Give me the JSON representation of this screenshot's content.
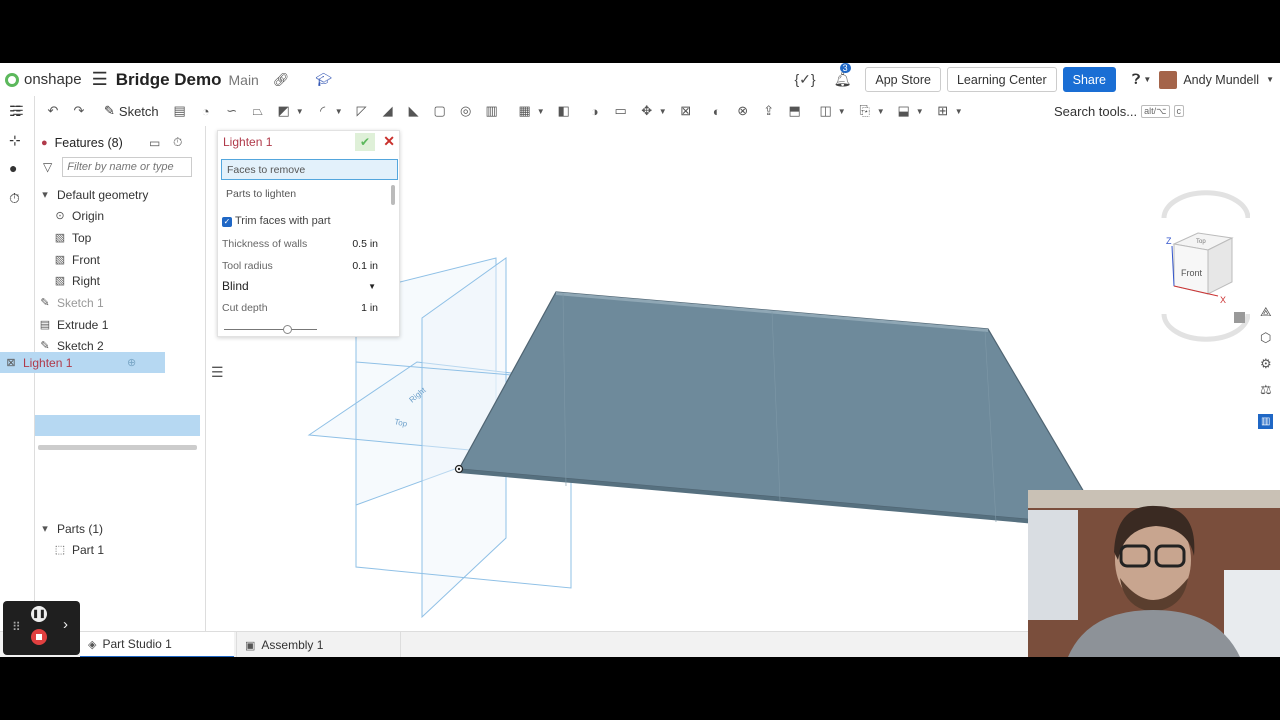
{
  "topbar": {
    "logo_text": "onshape",
    "doc_title": "Bridge Demo",
    "branch": "Main",
    "notifications_count": "3",
    "app_store": "App Store",
    "learning_center": "Learning Center",
    "share": "Share",
    "user_name": "Andy Mundell"
  },
  "toolbar": {
    "sketch_label": "Sketch",
    "search_label": "Search tools...",
    "search_shortcut_1": "alt/⌥",
    "search_shortcut_2": "c"
  },
  "tree": {
    "features_title": "Features (8)",
    "filter_placeholder": "Filter by name or type",
    "default_geometry": "Default geometry",
    "items": [
      "Origin",
      "Top",
      "Front",
      "Right",
      "Sketch 1",
      "Extrude 1",
      "Sketch 2",
      "Lighten 1"
    ],
    "parts_title": "Parts (1)",
    "part_1": "Part 1"
  },
  "dialog": {
    "title": "Lighten 1",
    "faces_to_remove": "Faces to remove",
    "parts_to_lighten": "Parts to lighten",
    "trim_faces": "Trim faces with part",
    "thickness_label": "Thickness of walls",
    "thickness_value": "0.5 in",
    "tool_radius_label": "Tool radius",
    "tool_radius_value": "0.1 in",
    "end_type": "Blind",
    "cut_depth_label": "Cut depth",
    "cut_depth_value": "1 in"
  },
  "viewcube": {
    "face_label": "Front",
    "top_label": "Top",
    "axis_z": "Z",
    "axis_x": "X"
  },
  "viewport": {
    "plane_top": "Top",
    "plane_right": "Right"
  },
  "tabs": {
    "part_studio": "Part Studio 1",
    "assembly": "Assembly 1"
  },
  "colors": {
    "part_fill": "#6e8a9b",
    "selection_blue": "#b6d8f2",
    "feature_red": "#b03a4a",
    "accent_blue": "#1a6ed4"
  }
}
